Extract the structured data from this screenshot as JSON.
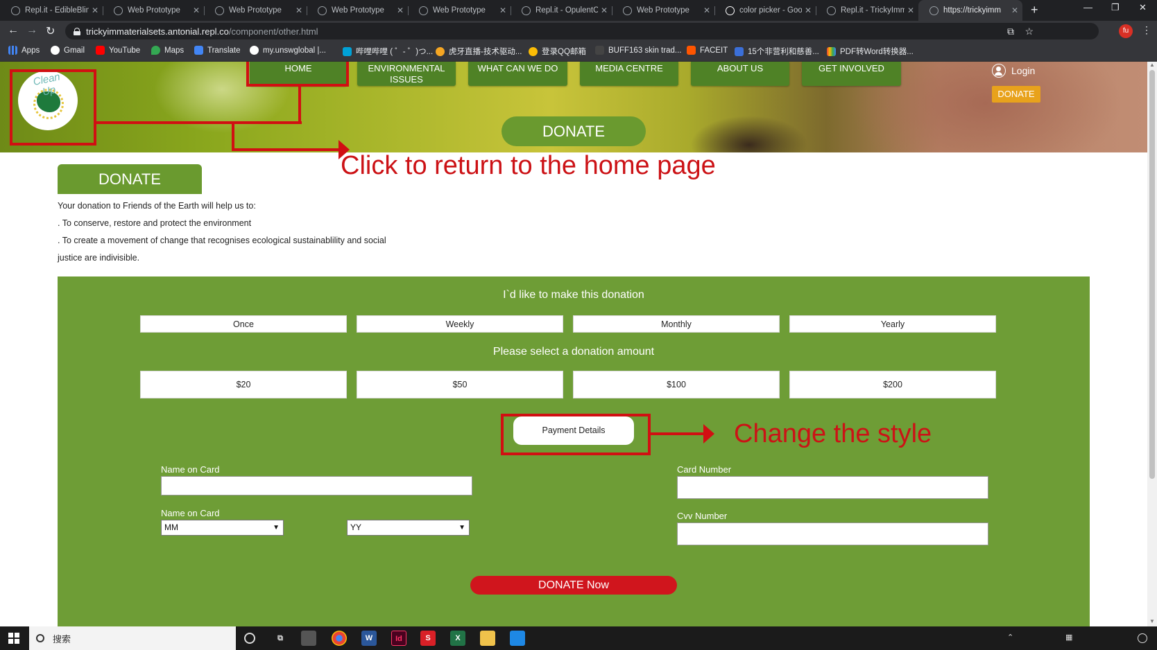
{
  "browser": {
    "tabs": [
      {
        "title": "Repl.it - EdibleBlin",
        "active": false
      },
      {
        "title": "Web Prototype",
        "active": false
      },
      {
        "title": "Web Prototype",
        "active": false
      },
      {
        "title": "Web Prototype",
        "active": false
      },
      {
        "title": "Web Prototype",
        "active": false
      },
      {
        "title": "Repl.it - OpulentC",
        "active": false
      },
      {
        "title": "Web Prototype",
        "active": false
      },
      {
        "title": "color picker - Goo",
        "active": false
      },
      {
        "title": "Repl.it - TrickyImm",
        "active": false
      },
      {
        "title": "https://trickyimm",
        "active": true
      }
    ],
    "url_host": "trickyimmaterialsets.antonial.repl.co",
    "url_path": "/component/other.html",
    "profile_initials": "fu",
    "bookmarks": [
      "Apps",
      "Gmail",
      "YouTube",
      "Maps",
      "Translate",
      "my.unswglobal |...",
      "哔哩哔哩 ( ゜- ゜)つ...",
      "虎牙直播-技术驱动...",
      "登录QQ邮箱",
      "BUFF163 skin trad...",
      "FACEIT",
      "15个非营利和慈善...",
      "PDF转Word转换器..."
    ]
  },
  "site": {
    "nav": [
      {
        "label": "HOME"
      },
      {
        "label": "ENVIRONMENTAL ISSUES"
      },
      {
        "label": "WHAT CAN WE DO"
      },
      {
        "label": "MEDIA CENTRE"
      },
      {
        "label": "ABOUT US"
      },
      {
        "label": "GET INVOLVED"
      }
    ],
    "logo_text": "Clean Up",
    "login_label": "Login",
    "header_donate_label": "DONATE",
    "hero_donate_label": "DONATE",
    "section_title": "DONATE",
    "intro_lines": [
      "Your donation to Friends of the Earth will help us to:",
      ". To conserve, restore and protect the environment",
      ". To create a movement of change that recognises ecological sustainablility and social",
      "justice are indivisible."
    ],
    "form": {
      "frequency_heading": "I`d like to make this donation",
      "frequencies": [
        "Once",
        "Weekly",
        "Monthly",
        "Yearly"
      ],
      "amount_heading": "Please select a donation amount",
      "amounts": [
        "$20",
        "$50",
        "$100",
        "$200"
      ],
      "payment_details_label": "Payment Details",
      "name_on_card_label": "Name on Card",
      "expiry_label": "Name on Card",
      "month_select": "MM",
      "year_select": "YY",
      "card_number_label": "Card Number",
      "cvv_label": "Cvv Number",
      "donate_now_label": "DONATE Now"
    }
  },
  "annotations": {
    "home_note": "Click to return to the home page",
    "style_note": "Change the style",
    "color": "#d10f12"
  },
  "taskbar": {
    "search_placeholder": "搜索"
  }
}
